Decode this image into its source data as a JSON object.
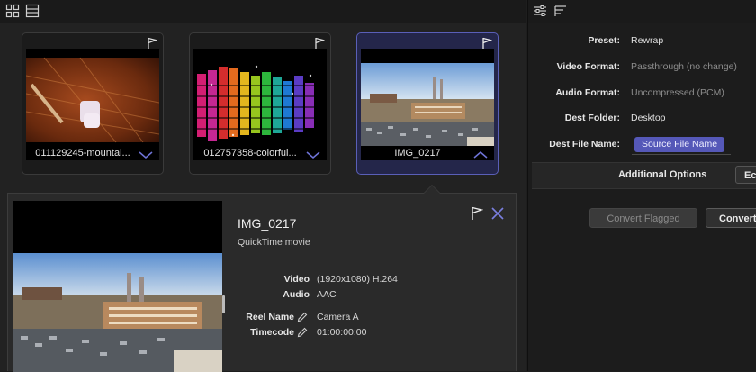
{
  "toolbar": {
    "icons": [
      "grid-view-icon",
      "list-view-icon",
      "sliders-icon",
      "sort-lines-icon"
    ]
  },
  "clips": [
    {
      "name": "011129245-mountai...",
      "flagged": false,
      "selected": false,
      "chevron": "down"
    },
    {
      "name": "012757358-colorful...",
      "flagged": false,
      "selected": false,
      "chevron": "down"
    },
    {
      "name": "IMG_0217",
      "flagged": false,
      "selected": true,
      "chevron": "up"
    }
  ],
  "detail": {
    "title": "IMG_0217",
    "subtitle": "QuickTime movie",
    "video_label": "Video",
    "video_value": "(1920x1080) H.264",
    "audio_label": "Audio",
    "audio_value": "AAC",
    "reel_label": "Reel Name",
    "reel_value": "Camera A",
    "timecode_label": "Timecode",
    "timecode_value": "01:00:00:00"
  },
  "settings": {
    "preset_label": "Preset:",
    "preset_value": "Rewrap",
    "video_format_label": "Video Format:",
    "video_format_value": "Passthrough (no change)",
    "audio_format_label": "Audio Format:",
    "audio_format_value": "Uncompressed (PCM)",
    "dest_folder_label": "Dest Folder:",
    "dest_folder_value": "Desktop",
    "dest_file_label": "Dest File Name:",
    "dest_file_value": "Source File Name",
    "additional_options_label": "Additional Options",
    "edit_button_label": "Ec",
    "convert_flagged_label": "Convert Flagged",
    "convert_label": "Convert"
  },
  "colors": {
    "accent": "#5558b8",
    "selected_card": "#24264a"
  }
}
